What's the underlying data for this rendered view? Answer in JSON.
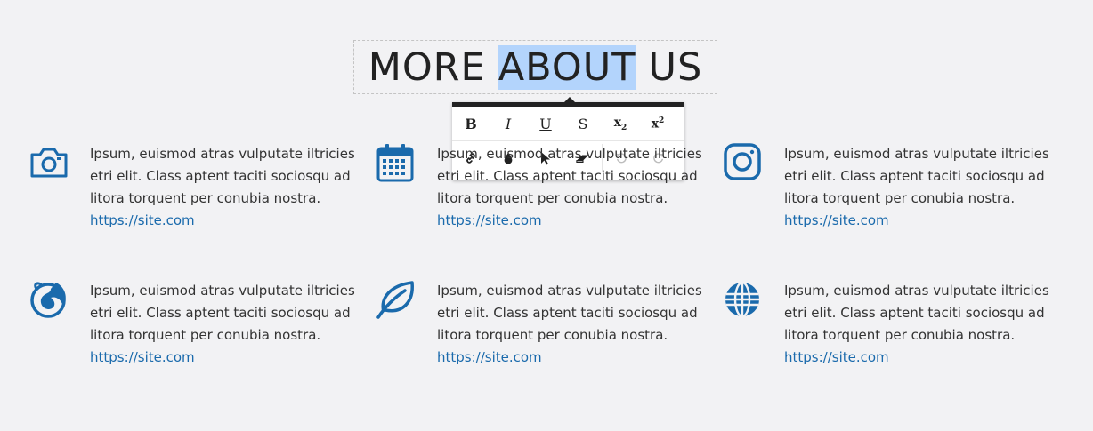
{
  "heading": {
    "before": "MORE",
    "selected": "ABOUT",
    "after": "US"
  },
  "toolbar": {
    "row1": [
      {
        "name": "bold-button",
        "icon": "bold",
        "glyph": "B"
      },
      {
        "name": "italic-button",
        "icon": "italic",
        "glyph": "I"
      },
      {
        "name": "underline-button",
        "icon": "underline",
        "glyph": "U"
      },
      {
        "name": "strikethrough-button",
        "icon": "strikethrough",
        "glyph": "S"
      },
      {
        "name": "subscript-button",
        "icon": "subscript",
        "glyph": "x",
        "script": "2"
      },
      {
        "name": "superscript-button",
        "icon": "superscript",
        "glyph": "x",
        "script": "2"
      }
    ],
    "row2": [
      {
        "name": "link-button",
        "icon": "link-icon"
      },
      {
        "name": "color-button",
        "icon": "droplet-icon"
      },
      {
        "name": "cursor-button",
        "icon": "cursor-icon"
      },
      {
        "name": "eraser-button",
        "icon": "eraser-icon"
      },
      {
        "name": "undo-button",
        "icon": "undo-icon",
        "disabled": true
      },
      {
        "name": "redo-button",
        "icon": "redo-icon",
        "disabled": true
      }
    ]
  },
  "features": [
    {
      "icon": "camera-icon",
      "text": "Ipsum, euismod atras vulputate iltricies etri elit. Class aptent taciti sociosqu ad litora torquent per conubia nostra.",
      "link": "https://site.com"
    },
    {
      "icon": "calendar-icon",
      "text": "Ipsum, euismod atras vulputate iltricies etri elit. Class aptent taciti sociosqu ad litora torquent per conubia nostra.",
      "link": "https://site.com"
    },
    {
      "icon": "instagram-icon",
      "text": "Ipsum, euismod atras vulputate iltricies etri elit. Class aptent taciti sociosqu ad litora torquent per conubia nostra.",
      "link": "https://site.com"
    },
    {
      "icon": "firefox-icon",
      "text": "Ipsum, euismod atras vulputate iltricies etri elit. Class aptent taciti sociosqu ad litora torquent per conubia nostra.",
      "link": "https://site.com"
    },
    {
      "icon": "leaf-icon",
      "text": "Ipsum, euismod atras vulputate iltricies etri elit. Class aptent taciti sociosqu ad litora torquent per conubia nostra.",
      "link": "https://site.com"
    },
    {
      "icon": "globe-icon",
      "text": "Ipsum, euismod atras vulputate iltricies etri elit. Class aptent taciti sociosqu ad litora torquent per conubia nostra.",
      "link": "https://site.com"
    }
  ],
  "colors": {
    "accent": "#1a6aac",
    "selection": "#b3d4fc",
    "toolbar_border": "#222222"
  }
}
